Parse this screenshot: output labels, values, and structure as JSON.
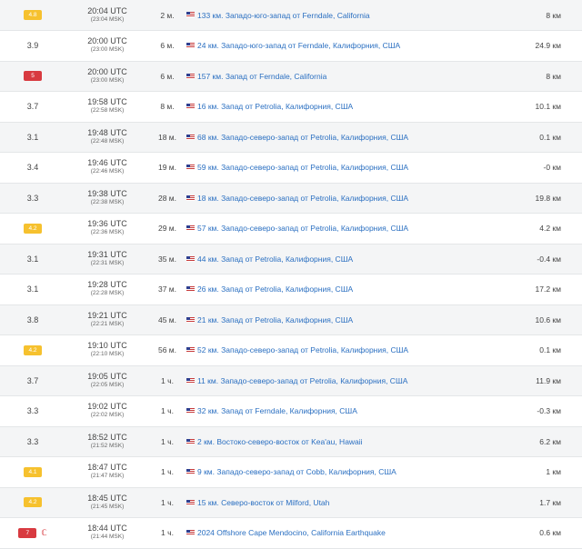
{
  "colors": {
    "link": "#2a6fc1",
    "badge_yellow": "#f6c12e",
    "badge_red": "#d83a40"
  },
  "rows": [
    {
      "mag": "4.8",
      "badge": "yellow",
      "utc": "20:04 UTC",
      "msk": "(23:04 MSK)",
      "ago": "2 м.",
      "place": "133 км. Западо-юго-запад от Ferndale, California",
      "depth": "8 км"
    },
    {
      "mag": "3.9",
      "badge": "",
      "utc": "20:00 UTC",
      "msk": "(23:00 MSK)",
      "ago": "6 м.",
      "place": "24 км. Западо-юго-запад от Ferndale, Калифорния, США",
      "depth": "24.9 км"
    },
    {
      "mag": "5",
      "badge": "red",
      "utc": "20:00 UTC",
      "msk": "(23:00 MSK)",
      "ago": "6 м.",
      "place": "157 км. Запад от Ferndale, California",
      "depth": "8 км"
    },
    {
      "mag": "3.7",
      "badge": "",
      "utc": "19:58 UTC",
      "msk": "(22:58 MSK)",
      "ago": "8 м.",
      "place": "16 км. Запад от Petrolia, Калифорния, США",
      "depth": "10.1 км"
    },
    {
      "mag": "3.1",
      "badge": "",
      "utc": "19:48 UTC",
      "msk": "(22:48 MSK)",
      "ago": "18 м.",
      "place": "68 км. Западо-северо-запад от Petrolia, Калифорния, США",
      "depth": "0.1 км"
    },
    {
      "mag": "3.4",
      "badge": "",
      "utc": "19:46 UTC",
      "msk": "(22:46 MSK)",
      "ago": "19 м.",
      "place": "59 км. Западо-северо-запад от Petrolia, Калифорния, США",
      "depth": "-0 км"
    },
    {
      "mag": "3.3",
      "badge": "",
      "utc": "19:38 UTC",
      "msk": "(22:38 MSK)",
      "ago": "28 м.",
      "place": "18 км. Западо-северо-запад от Petrolia, Калифорния, США",
      "depth": "19.8 км"
    },
    {
      "mag": "4.2",
      "badge": "yellow",
      "utc": "19:36 UTC",
      "msk": "(22:36 MSK)",
      "ago": "29 м.",
      "place": "57 км. Западо-северо-запад от Petrolia, Калифорния, США",
      "depth": "4.2 км"
    },
    {
      "mag": "3.1",
      "badge": "",
      "utc": "19:31 UTC",
      "msk": "(22:31 MSK)",
      "ago": "35 м.",
      "place": "44 км. Запад от Petrolia, Калифорния, США",
      "depth": "-0.4 км"
    },
    {
      "mag": "3.1",
      "badge": "",
      "utc": "19:28 UTC",
      "msk": "(22:28 MSK)",
      "ago": "37 м.",
      "place": "26 км. Запад от Petrolia, Калифорния, США",
      "depth": "17.2 км"
    },
    {
      "mag": "3.8",
      "badge": "",
      "utc": "19:21 UTC",
      "msk": "(22:21 MSK)",
      "ago": "45 м.",
      "place": "21 км. Запад от Petrolia, Калифорния, США",
      "depth": "10.6 км"
    },
    {
      "mag": "4.2",
      "badge": "yellow",
      "utc": "19:10 UTC",
      "msk": "(22:10 MSK)",
      "ago": "56 м.",
      "place": "52 км. Западо-северо-запад от Petrolia, Калифорния, США",
      "depth": "0.1 км"
    },
    {
      "mag": "3.7",
      "badge": "",
      "utc": "19:05 UTC",
      "msk": "(22:05 MSK)",
      "ago": "1 ч.",
      "place": "11 км. Западо-северо-запад от Petrolia, Калифорния, США",
      "depth": "11.9 км"
    },
    {
      "mag": "3.3",
      "badge": "",
      "utc": "19:02 UTC",
      "msk": "(22:02 MSK)",
      "ago": "1 ч.",
      "place": "32 км. Запад от Ferndale, Калифорния, США",
      "depth": "-0.3 км"
    },
    {
      "mag": "3.3",
      "badge": "",
      "utc": "18:52 UTC",
      "msk": "(21:52 MSK)",
      "ago": "1 ч.",
      "place": "2 км. Востоко-северо-восток от Kea'au, Hawaii",
      "depth": "6.2 км"
    },
    {
      "mag": "4.1",
      "badge": "yellow",
      "utc": "18:47 UTC",
      "msk": "(21:47 MSK)",
      "ago": "1 ч.",
      "place": "9 км. Западо-северо-запад от Cobb, Калифорния, США",
      "depth": "1 км"
    },
    {
      "mag": "4.2",
      "badge": "yellow",
      "utc": "18:45 UTC",
      "msk": "(21:45 MSK)",
      "ago": "1 ч.",
      "place": "15 км. Северо-восток от Milford, Utah",
      "depth": "1.7 км"
    },
    {
      "mag": "7",
      "badge": "red",
      "alert_icon": "alert-icon",
      "utc": "18:44 UTC",
      "msk": "(21:44 MSK)",
      "ago": "1 ч.",
      "place": "2024 Offshore Cape Mendocino, California Earthquake",
      "depth": "0.6 км"
    }
  ]
}
